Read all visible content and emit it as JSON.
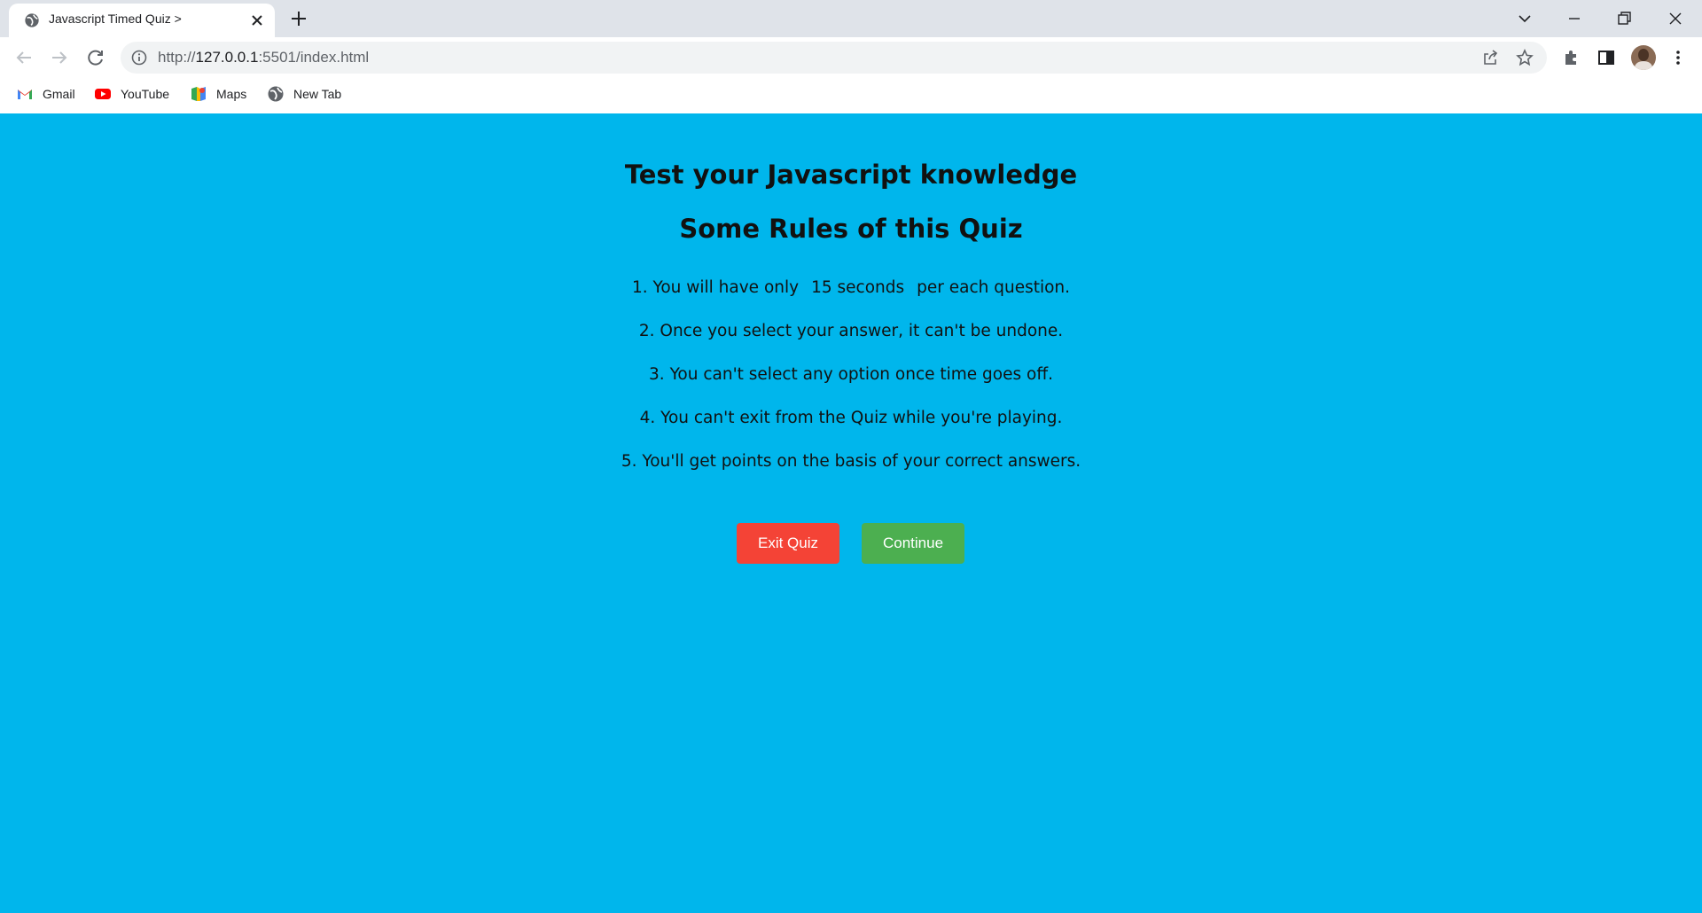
{
  "browser": {
    "tab_title": "Javascript Timed Quiz >",
    "url_prefix": "http://",
    "url_host": "127.0.0.1",
    "url_rest": ":5501/index.html",
    "bookmarks": [
      {
        "label": "Gmail",
        "icon": "gmail-icon"
      },
      {
        "label": "YouTube",
        "icon": "youtube-icon"
      },
      {
        "label": "Maps",
        "icon": "maps-icon"
      },
      {
        "label": "New Tab",
        "icon": "globe-icon"
      }
    ]
  },
  "page": {
    "background": "#00b6ec",
    "title": "Test your Javascript knowledge",
    "subtitle": "Some Rules of this Quiz",
    "rules": [
      {
        "pre": "1. You will have only",
        "highlight": "15 seconds",
        "post": "per each question."
      },
      {
        "text": "2. Once you select your answer, it can't be undone."
      },
      {
        "text": "3. You can't select any option once time goes off."
      },
      {
        "text": "4. You can't exit from the Quiz while you're playing."
      },
      {
        "text": "5. You'll get points on the basis of your correct answers."
      }
    ],
    "buttons": {
      "exit_label": "Exit Quiz",
      "exit_color": "#f44336",
      "continue_label": "Continue",
      "continue_color": "#4caf50"
    }
  }
}
